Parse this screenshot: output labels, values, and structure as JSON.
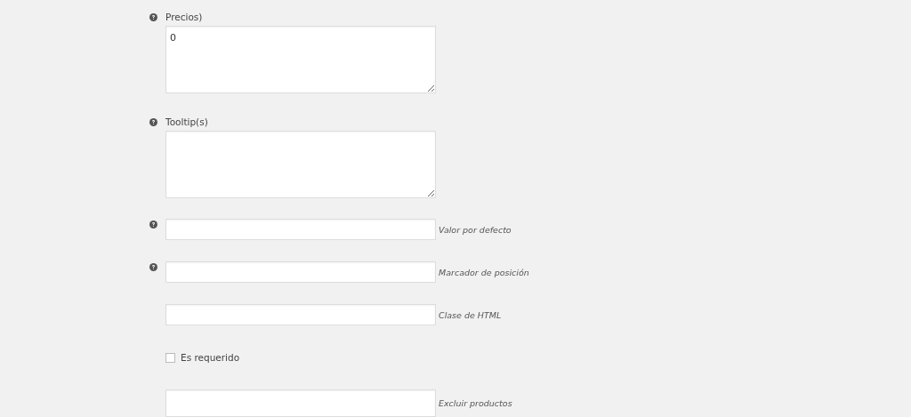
{
  "fields": [
    {
      "kind": "textarea",
      "help": true,
      "label": "Precios)",
      "value": "0"
    },
    {
      "kind": "textarea",
      "help": true,
      "label": "Tooltip(s)"
    },
    {
      "kind": "input",
      "help": true,
      "description": "Valor por defecto"
    },
    {
      "kind": "input",
      "help": true,
      "description": "Marcador de posición"
    },
    {
      "kind": "input",
      "help": false,
      "description": "Clase de HTML"
    },
    {
      "kind": "checkbox",
      "label": "Es requerido",
      "checked": false
    },
    {
      "kind": "input",
      "help": false,
      "description": "Excluir productos",
      "tall": true
    }
  ]
}
